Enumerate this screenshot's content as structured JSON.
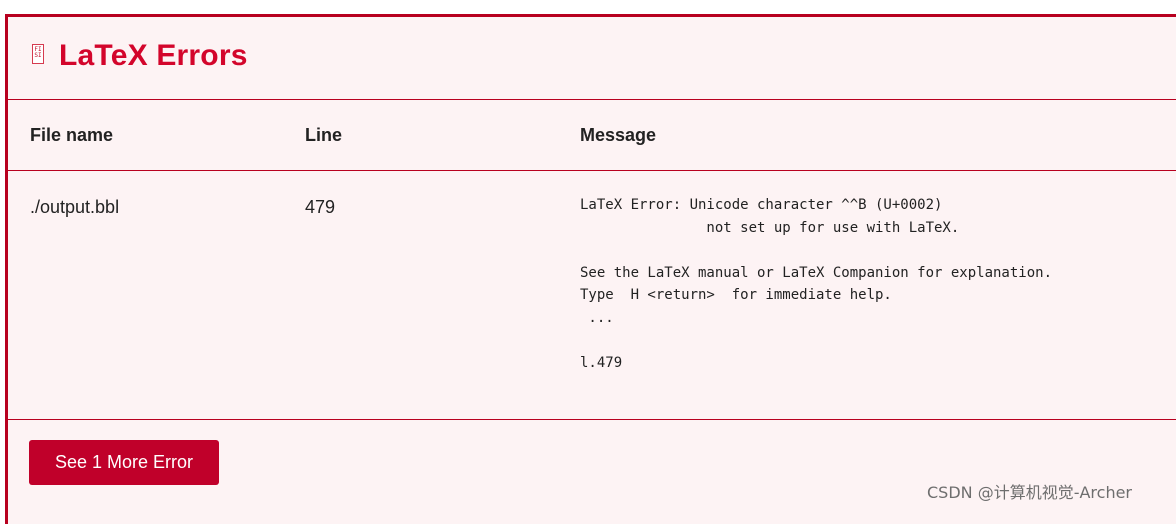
{
  "header": {
    "icon": "document-icon",
    "icon_text": "FI\nSI",
    "title": "LaTeX Errors"
  },
  "table": {
    "columns": {
      "file": "File name",
      "line": "Line",
      "message": "Message"
    },
    "rows": [
      {
        "file": "./output.bbl",
        "line": "479",
        "message": "LaTeX Error: Unicode character ^^B (U+0002)\n               not set up for use with LaTeX.\n\nSee the LaTeX manual or LaTeX Companion for explanation.\nType  H <return>  for immediate help.\n ...\n\nl.479"
      }
    ]
  },
  "footer": {
    "more_button": "See 1 More Error"
  },
  "watermark": "CSDN @计算机视觉-Archer",
  "colors": {
    "accent": "#c0002a",
    "title": "#d3052b",
    "panel_background": "#fdf3f4"
  }
}
